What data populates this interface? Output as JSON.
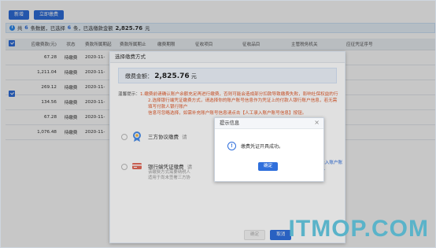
{
  "toolbar": {
    "btn_new": "新增",
    "btn_pay": "立即缴费"
  },
  "info_bar": {
    "prefix": "共",
    "total_count": "6",
    "mid1": "条数据，已选择",
    "selected_count": "6",
    "mid2": "条，已选缴款金额",
    "amount": "2,825.76",
    "suffix": "元"
  },
  "table": {
    "headers": [
      "应缴费款(元)",
      "状态",
      "费款所属期起",
      "费款所属期止",
      "缴费期限",
      "征收项目",
      "征收品目",
      "主管税务机关",
      "应征凭证序号"
    ],
    "rows": [
      {
        "amount": "67.28",
        "status": "待缴费",
        "period": "2020-11-"
      },
      {
        "amount": "1,211.04",
        "status": "待缴费",
        "period": "2020-11-"
      },
      {
        "amount": "269.12",
        "status": "待缴费",
        "period": "2020-11-"
      },
      {
        "amount": "134.56",
        "status": "待缴费",
        "period": "2020-11-"
      },
      {
        "amount": "67.28",
        "status": "待缴费",
        "period": "2020-11-"
      },
      {
        "amount": "1,076.48",
        "status": "待缴费",
        "period": "2020-11-"
      }
    ]
  },
  "dialog": {
    "title": "选择缴费方式",
    "total_label": "缴费金额：",
    "total_value": "2,825.76",
    "total_unit": "元",
    "tip_label": "温馨提示：",
    "tip_1": "1.缴费前请确认账户余额充足再进行缴费，否则可能会造成部分扣款导致缴费失败，影响社保权益的行",
    "tip_2": "2.选择银行端凭证缴费方式，请选择你的账户账号信息作为凭证上的付款人银行账户信息，若无需填写付款人银行账户",
    "tip_3": "信息可忽略选择，如需补充账户账号信息请点击【人工录入账户账号信息】按钮。",
    "option_1_label": "三方协议缴费",
    "option_1_trail": "请",
    "option_2_label": "银行端凭证缴费",
    "option_2_trail": "请",
    "option_2_desc_1": "该缴费方式需要纳税人",
    "option_2_desc_2": "适用于尚未签署三方协",
    "manual_link": "人工录入账户账号信息",
    "btn_confirm": "确定",
    "btn_cancel": "取消"
  },
  "message": {
    "title": "提示信息",
    "close": "×",
    "text": "缴费凭证开具成功。",
    "ok": "确定",
    "icon": "info-icon"
  },
  "watermark": "ITMOP.COM",
  "colors": {
    "primary": "#2f6fdc",
    "tip_red": "#e05a2b",
    "watermark": "#5ab3c9"
  }
}
